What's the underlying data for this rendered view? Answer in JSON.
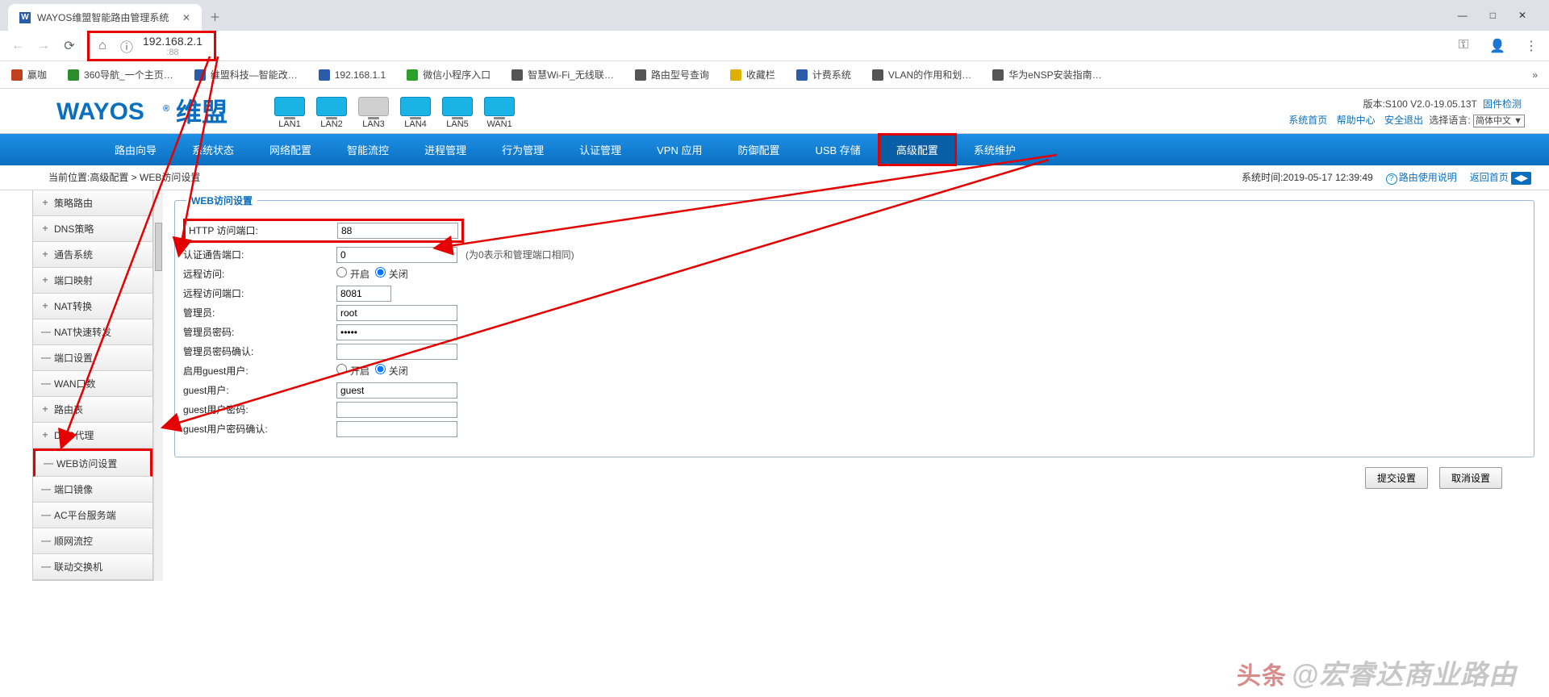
{
  "browser": {
    "tab_title": "WAYOS维盟智能路由管理系统",
    "url_host": "192.168.2.1",
    "url_port": ":88",
    "win": {
      "min": "—",
      "max": "□",
      "close": "✕"
    }
  },
  "bookmarks": [
    {
      "icon": "#c04020",
      "label": "赢咖"
    },
    {
      "icon": "#2a8f2a",
      "label": "360导航_一个主页…"
    },
    {
      "icon": "#2a5caa",
      "label": "维盟科技—智能改…"
    },
    {
      "icon": "#2a5caa",
      "label": "192.168.1.1"
    },
    {
      "icon": "#2aa02a",
      "label": "微信小程序入口"
    },
    {
      "icon": "#555",
      "label": "智慧Wi-Fi_无线联…"
    },
    {
      "icon": "#555",
      "label": "路由型号查询"
    },
    {
      "icon": "#e0b000",
      "label": "收藏栏"
    },
    {
      "icon": "#2a5caa",
      "label": "计费系统"
    },
    {
      "icon": "#555",
      "label": "VLAN的作用和划…"
    },
    {
      "icon": "#555",
      "label": "华为eNSP安装指南…"
    }
  ],
  "ports": [
    {
      "name": "LAN1",
      "on": true
    },
    {
      "name": "LAN2",
      "on": true
    },
    {
      "name": "LAN3",
      "on": false
    },
    {
      "name": "LAN4",
      "on": true
    },
    {
      "name": "LAN5",
      "on": true
    },
    {
      "name": "WAN1",
      "on": true
    }
  ],
  "router_info": {
    "version_label": "版本:S100 V2.0-19.05.13T",
    "fw_link": "固件检测",
    "links": [
      "系统首页",
      "帮助中心",
      "安全退出"
    ],
    "lang_label": "选择语言:",
    "lang_value": "简体中文 ▼"
  },
  "menu": [
    "路由向导",
    "系统状态",
    "网络配置",
    "智能流控",
    "进程管理",
    "行为管理",
    "认证管理",
    "VPN 应用",
    "防御配置",
    "USB 存储",
    "高级配置",
    "系统维护"
  ],
  "menu_active_index": 10,
  "crumb": {
    "loc": "当前位置:高级配置 > WEB访问设置",
    "time": "系统时间:2019-05-17 12:39:49",
    "help": "路由使用说明",
    "back": "返回首页"
  },
  "side": [
    {
      "pm": "+",
      "t": "策略路由"
    },
    {
      "pm": "+",
      "t": "DNS策略"
    },
    {
      "pm": "+",
      "t": "通告系统"
    },
    {
      "pm": "+",
      "t": "端口映射"
    },
    {
      "pm": "+",
      "t": "NAT转换"
    },
    {
      "pm": "—",
      "t": "NAT快速转发"
    },
    {
      "pm": "—",
      "t": "端口设置"
    },
    {
      "pm": "—",
      "t": "WAN口数"
    },
    {
      "pm": "+",
      "t": "路由表"
    },
    {
      "pm": "+",
      "t": "DNS代理"
    },
    {
      "pm": "—",
      "t": "WEB访问设置"
    },
    {
      "pm": "—",
      "t": "端口镜像"
    },
    {
      "pm": "—",
      "t": "AC平台服务端"
    },
    {
      "pm": "—",
      "t": "顺网流控"
    },
    {
      "pm": "—",
      "t": "联动交换机"
    }
  ],
  "side_active_index": 10,
  "panel_title": "WEB访问设置",
  "form": {
    "http_port": {
      "label": "HTTP 访问端口:",
      "value": "88"
    },
    "auth_port": {
      "label": "认证通告端口:",
      "value": "0",
      "hint": "(为0表示和管理端口相同)"
    },
    "remote": {
      "label": "远程访问:",
      "on": "开启",
      "off": "关闭",
      "value": "off"
    },
    "remote_port": {
      "label": "远程访问端口:",
      "value": "8081"
    },
    "admin": {
      "label": "管理员:",
      "value": "root"
    },
    "admin_pw": {
      "label": "管理员密码:",
      "value": "•••••"
    },
    "admin_pw2": {
      "label": "管理员密码确认:",
      "value": ""
    },
    "guest_en": {
      "label": "启用guest用户:",
      "on": "开启",
      "off": "关闭",
      "value": "off"
    },
    "guest": {
      "label": "guest用户:",
      "value": "guest"
    },
    "guest_pw": {
      "label": "guest用户密码:",
      "value": ""
    },
    "guest_pw2": {
      "label": "guest用户密码确认:",
      "value": ""
    }
  },
  "buttons": {
    "submit": "提交设置",
    "cancel": "取消设置"
  },
  "watermark": {
    "head": "头条",
    "text": "@宏睿达商业路由"
  }
}
